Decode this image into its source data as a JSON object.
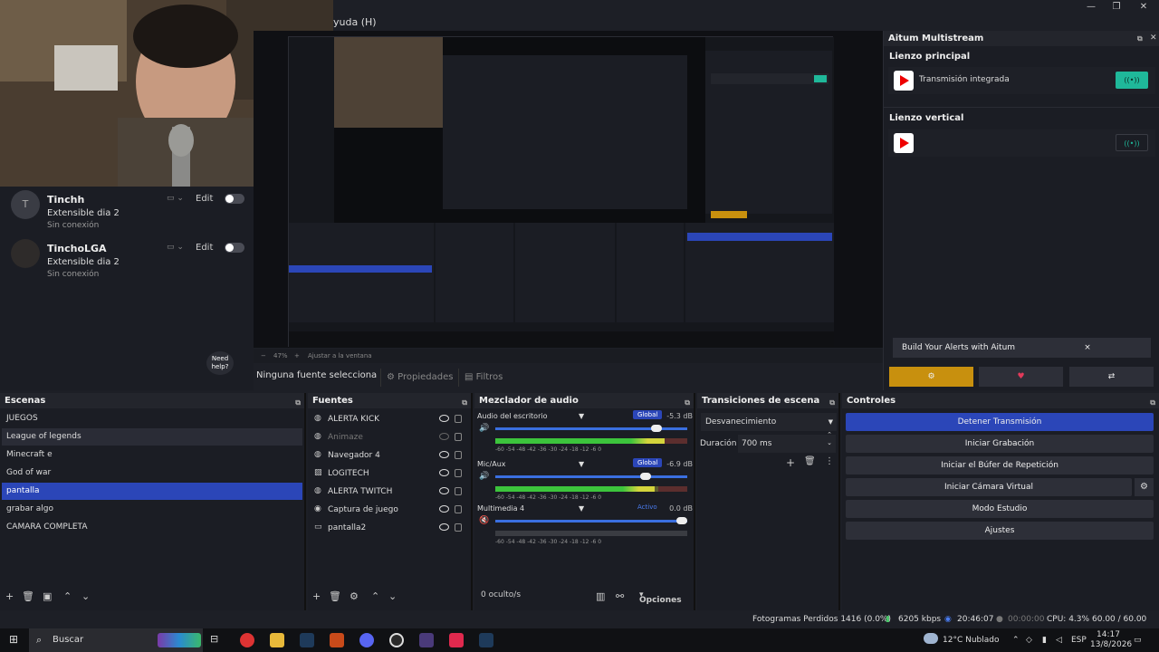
{
  "window": {
    "menu_partial": "yuda (H)"
  },
  "chat": {
    "users": [
      {
        "avatar": "T",
        "name": "Tinchh",
        "status": "Extensible dia 2",
        "connection": "Sin conexión",
        "edit": "Edit"
      },
      {
        "avatar": "",
        "name": "TinchoLGA",
        "status": "Extensible dia 2",
        "connection": "Sin conexión",
        "edit": "Edit"
      }
    ],
    "help": "Need help?"
  },
  "preview": {
    "zoom": "47%",
    "fit": "Ajustar a la ventana"
  },
  "sourcebar": {
    "selected": "Ninguna fuente selecciona",
    "properties": "Propiedades",
    "filters": "Filtros"
  },
  "aitum": {
    "title": "Aitum Multistream",
    "main_canvas": "Lienzo principal",
    "vertical_canvas": "Lienzo vertical",
    "integrated_stream": "Transmisión integrada",
    "build_alerts": "Build Your Alerts with Aitum",
    "close": "×",
    "live_color": "#1fb89a"
  },
  "scenes": {
    "title": "Escenas",
    "items": [
      "JUEGOS",
      "League of legends",
      "Minecraft e",
      "God of war",
      "pantalla",
      "grabar algo",
      "CAMARA COMPLETA"
    ],
    "selected": "pantalla"
  },
  "sources": {
    "title": "Fuentes",
    "items": [
      {
        "icon": "globe-icon",
        "name": "ALERTA KICK",
        "visible": true
      },
      {
        "icon": "globe-icon",
        "name": "Animaze",
        "visible": false
      },
      {
        "icon": "globe-icon",
        "name": "Navegador 4",
        "visible": true
      },
      {
        "icon": "image-icon",
        "name": "LOGITECH",
        "visible": true
      },
      {
        "icon": "globe-icon",
        "name": "ALERTA TWITCH",
        "visible": true
      },
      {
        "icon": "gamepad-icon",
        "name": "Captura de juego",
        "visible": true
      },
      {
        "icon": "monitor-icon",
        "name": "pantalla2",
        "visible": true
      }
    ]
  },
  "mixer": {
    "title": "Mezclador de audio",
    "channels": [
      {
        "name": "Audio del escritorio",
        "tag": "Global",
        "db": "-5.3 dB",
        "volume": 0.86,
        "level": 0.88
      },
      {
        "name": "Mic/Aux",
        "tag": "Global",
        "db": "-6.9 dB",
        "volume": 0.8,
        "level": 0.83
      },
      {
        "name": "Multimedia 4",
        "tag": "Activo",
        "db": "0.0 dB",
        "volume": 1.0,
        "level": 0
      }
    ],
    "scale": "-60  -54  -48  -42  -36  -30  -24  -18  -12   -6    0",
    "hidden": "0 oculto/s",
    "options": "Opciones"
  },
  "transitions": {
    "title": "Transiciones de escena",
    "type": "Desvanecimiento",
    "duration_label": "Duración",
    "duration": "700 ms"
  },
  "controls": {
    "title": "Controles",
    "stop_stream": "Detener Transmisión",
    "start_record": "Iniciar Grabación",
    "replay_buffer": "Iniciar el Búfer de Repetición",
    "virtual_cam": "Iniciar Cámara Virtual",
    "studio_mode": "Modo Estudio",
    "settings": "Ajustes"
  },
  "status": {
    "dropped": "Fotogramas Perdidos 1416 (0.0%)",
    "bitrate": "6205 kbps",
    "stream_time": "20:46:07",
    "record_time": "00:00:00",
    "cpu": "CPU: 4.3%",
    "fps": "60.00 / 60.00 FPS"
  },
  "taskbar": {
    "search": "Buscar",
    "weather": "12°C  Nublado",
    "lang": "ESP",
    "time": "14:17",
    "date": "13/8/2026"
  }
}
